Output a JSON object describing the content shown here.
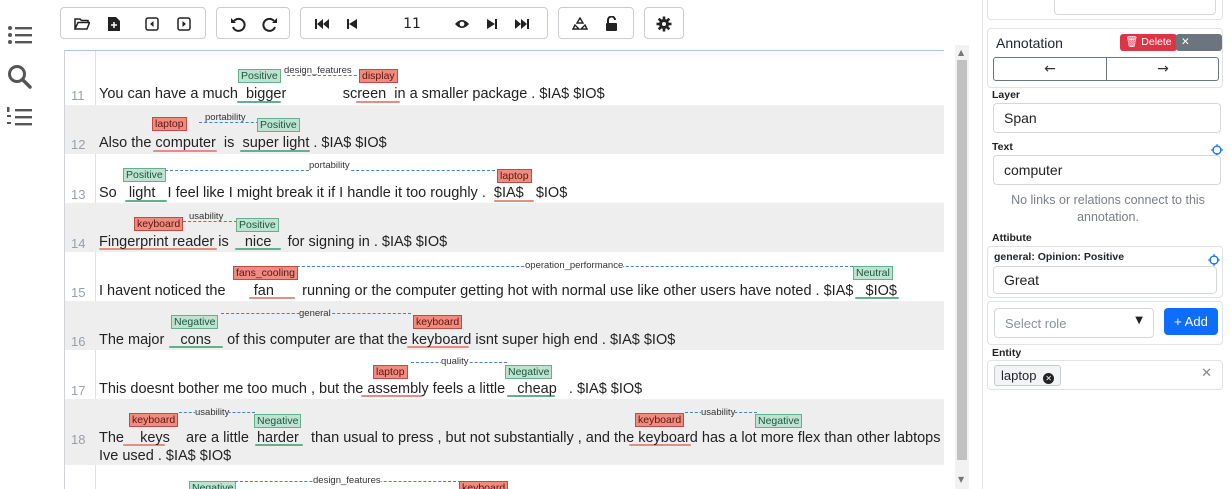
{
  "toolbar": {
    "page_number": "11"
  },
  "document": {
    "lines": [
      {
        "num": "11",
        "text": "You can have a much  bigger              screen  in a smaller package . $IA$ $IO$",
        "labels": [
          "Positive",
          "display"
        ],
        "relations": [
          "design_features"
        ]
      },
      {
        "num": "12",
        "text": "Also the computer  is  super light . $IA$ $IO$",
        "labels": [
          "laptop",
          "Positive"
        ],
        "relations": [
          "portability"
        ]
      },
      {
        "num": "13",
        "text": "So   light   I feel like I might break it if I handle it too roughly .  $IA$   $IO$",
        "labels": [
          "Positive",
          "laptop"
        ],
        "relations": [
          "portability"
        ]
      },
      {
        "num": "14",
        "text": "Fingerprint reader is    nice    for signing in . $IA$ $IO$",
        "labels": [
          "keyboard",
          "Positive"
        ],
        "relations": [
          "usability"
        ]
      },
      {
        "num": "15",
        "text": "I havent noticed the       fan       running or the computer getting hot with normal use like other users have noted . $IA$   $IO$",
        "labels": [
          "fans_cooling",
          "Neutral"
        ],
        "relations": [
          "operation_performance"
        ]
      },
      {
        "num": "16",
        "text": "The major    cons    of this computer are that the keyboard isnt super high end . $IA$ $IO$",
        "labels": [
          "Negative",
          "keyboard"
        ],
        "relations": [
          "general"
        ]
      },
      {
        "num": "17",
        "text": "This doesnt bother me too much , but the assembly feels a little   cheap   . $IA$ $IO$",
        "labels": [
          "laptop",
          "Negative"
        ],
        "relations": [
          "quality"
        ]
      },
      {
        "num": "18",
        "text": "The    keys    are a little  harder   than usual to press , but not substantially , and the keyboard has a lot more flex than other labtops",
        "text2": "Ive used . $IA$ $IO$",
        "labels": [
          "keyboard",
          "Negative",
          "keyboard",
          "Negative"
        ],
        "relations": [
          "usability",
          "usability"
        ]
      },
      {
        "num": "",
        "labels": [
          "Negative",
          "keyboard"
        ],
        "relations": [
          "design_features"
        ]
      }
    ]
  },
  "panel": {
    "annotation_title": "Annotation",
    "delete_label": "Delete",
    "clear_label": "Clear",
    "layer_title": "Layer",
    "layer_value": "Span",
    "text_title": "Text",
    "text_value": "computer",
    "note": "No links or relations connect to this annotation.",
    "attribute_title": "Attibute",
    "feature_title": "general: Opinion: Positive",
    "feature_value": "Great",
    "role_placeholder": "Select role",
    "add_label": "Add",
    "entity_title": "Entity",
    "entity_tag": "laptop"
  },
  "colors": {
    "positive": "#bfe2d3",
    "negative_label": "#f08b80",
    "accent": "#0d6efd",
    "danger": "#dc3545"
  }
}
